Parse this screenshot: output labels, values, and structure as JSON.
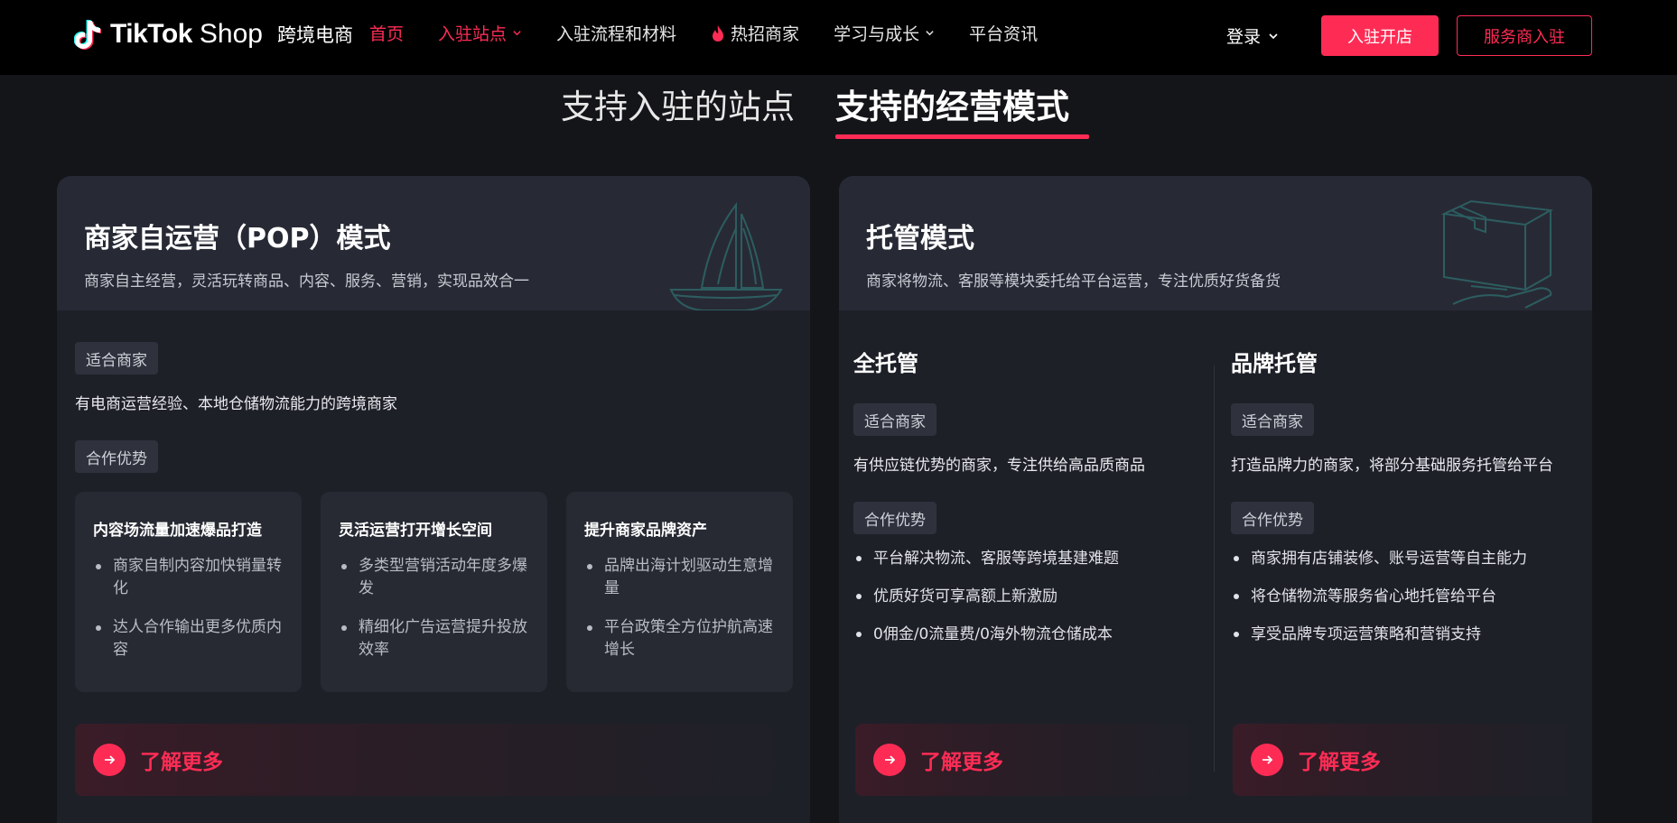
{
  "header": {
    "logo_brand": "TikTok",
    "logo_shop": "Shop",
    "logo_sub": "跨境电商",
    "nav": [
      {
        "label": "首页"
      },
      {
        "label": "入驻站点"
      },
      {
        "label": "入驻流程和材料"
      },
      {
        "label": "热招商家"
      },
      {
        "label": "学习与成长"
      },
      {
        "label": "平台资讯"
      }
    ],
    "login_label": "登录",
    "primary_button": "入驻开店",
    "outline_button": "服务商入驻"
  },
  "section_tabs": [
    {
      "label": "支持入驻的站点"
    },
    {
      "label": "支持的经营模式"
    }
  ],
  "pop_card": {
    "title": "商家自运营（POP）模式",
    "desc": "商家自主经营，灵活玩转商品、内容、服务、营销，实现品效合一",
    "fit_tag": "适合商家",
    "fit_text": "有电商运营经验、本地仓储物流能力的跨境商家",
    "adv_tag": "合作优势",
    "advantages": [
      {
        "title": "内容场流量加速爆品打造",
        "items": [
          "商家自制内容加快销量转化",
          "达人合作输出更多优质内容"
        ]
      },
      {
        "title": "灵活运营打开增长空间",
        "items": [
          "多类型营销活动年度多爆发",
          "精细化广告运营提升投放效率"
        ]
      },
      {
        "title": "提升商家品牌资产",
        "items": [
          "品牌出海计划驱动生意增量",
          "平台政策全方位护航高速增长"
        ]
      }
    ],
    "more_label": "了解更多"
  },
  "managed_card": {
    "title": "托管模式",
    "desc": "商家将物流、客服等模块委托给平台运营，专注优质好货备货",
    "full": {
      "title": "全托管",
      "fit_tag": "适合商家",
      "fit_text": "有供应链优势的商家，专注供给高品质商品",
      "adv_tag": "合作优势",
      "items": [
        "平台解决物流、客服等跨境基建难题",
        "优质好货可享高额上新激励",
        "0佣金/0流量费/0海外物流仓储成本"
      ],
      "more_label": "了解更多"
    },
    "brand": {
      "title": "品牌托管",
      "fit_tag": "适合商家",
      "fit_text": "打造品牌力的商家，将部分基础服务托管给平台",
      "adv_tag": "合作优势",
      "items": [
        "商家拥有店铺装修、账号运营等自主能力",
        "将仓储物流等服务省心地托管给平台",
        "享受品牌专项运营策略和营销支持"
      ],
      "more_label": "了解更多"
    }
  },
  "colors": {
    "accent": "#fe2c55",
    "card": "#1e2028",
    "card_head": "#272a35",
    "page": "#141519"
  }
}
